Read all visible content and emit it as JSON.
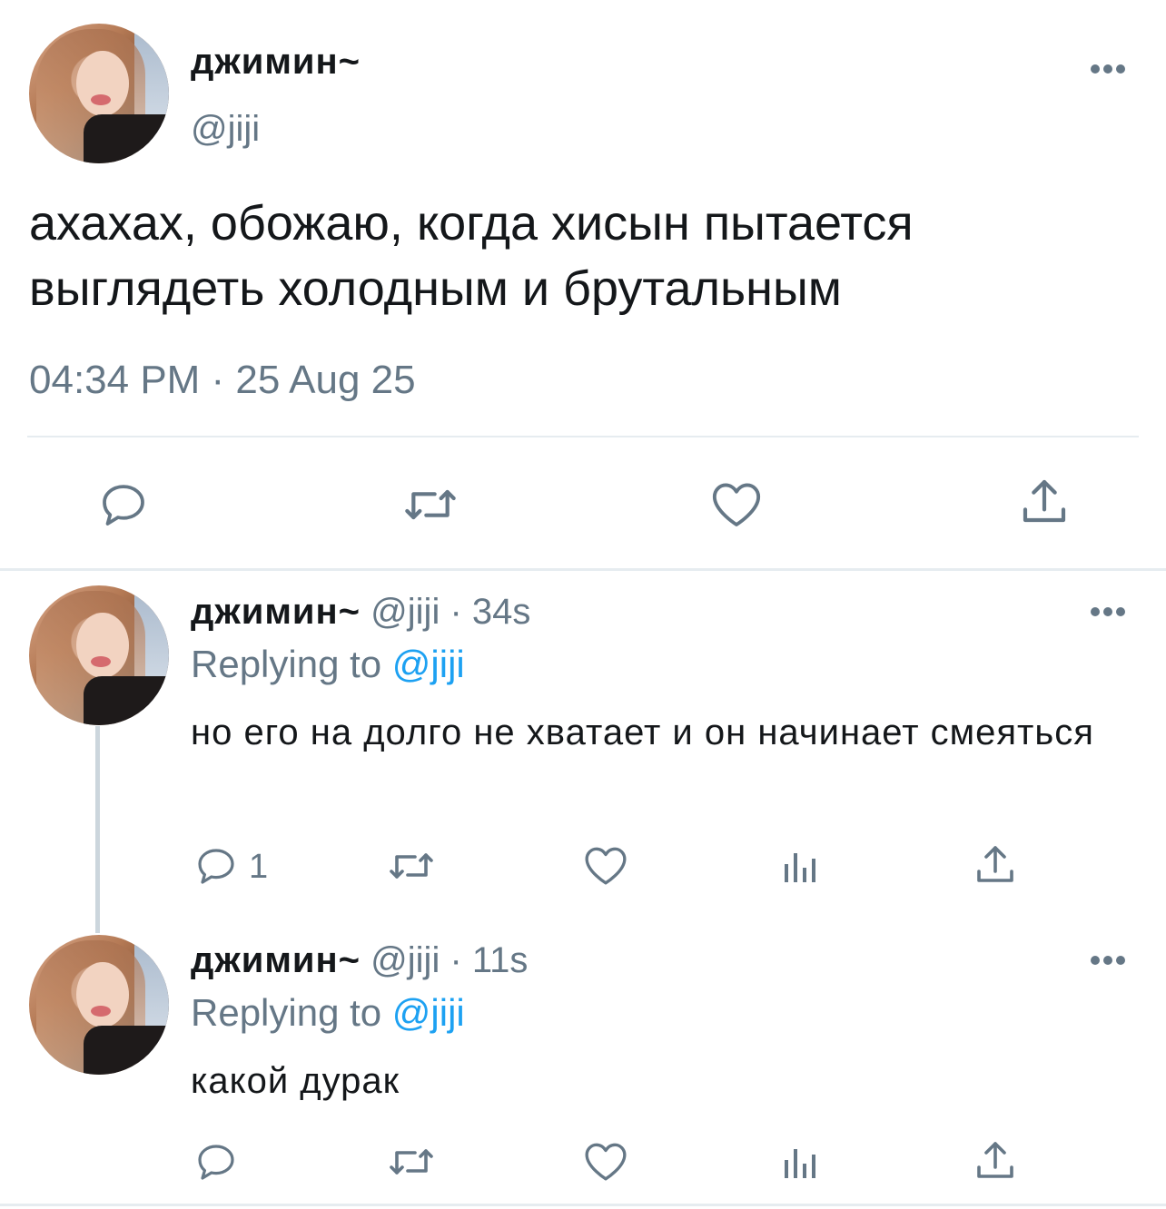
{
  "main_tweet": {
    "author_name": "джимин~",
    "author_handle": "@jiji",
    "text": "ахахах, обожаю, когда хисын пытается выглядеть холодным и брутальным",
    "timestamp": "04:34 PM · 25 Aug 25"
  },
  "replies": [
    {
      "author_name": "джимин~",
      "meta": "@jiji · 34s",
      "replying_prefix": "Replying to ",
      "replying_handle": "@jiji",
      "text": "но его на долго не хватает и он начинает смеяться",
      "reply_count": "1"
    },
    {
      "author_name": "джимин~",
      "meta": "@jiji · 11s",
      "replying_prefix": "Replying to ",
      "replying_handle": "@jiji",
      "text": "какой дурак",
      "reply_count": ""
    }
  ],
  "icons": [
    "reply-icon",
    "retweet-icon",
    "like-icon",
    "share-icon",
    "analytics-icon",
    "more-icon"
  ],
  "colors": {
    "text": "#14171a",
    "muted": "#657786",
    "accent": "#1da1f2",
    "divider": "#e6ecf0"
  }
}
